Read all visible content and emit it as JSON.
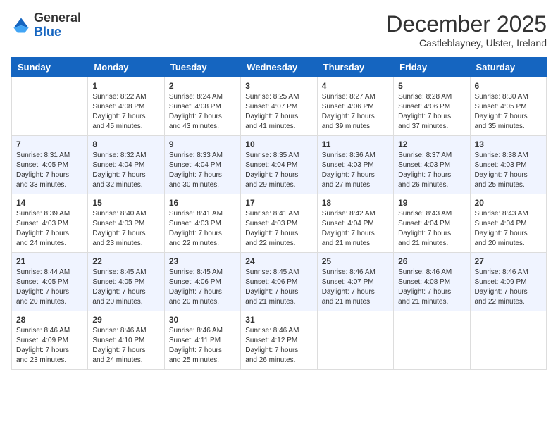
{
  "header": {
    "logo": {
      "general": "General",
      "blue": "Blue"
    },
    "title": "December 2025",
    "location": "Castleblayney, Ulster, Ireland"
  },
  "calendar": {
    "days_of_week": [
      "Sunday",
      "Monday",
      "Tuesday",
      "Wednesday",
      "Thursday",
      "Friday",
      "Saturday"
    ],
    "weeks": [
      [
        {
          "day": "",
          "content": ""
        },
        {
          "day": "1",
          "content": "Sunrise: 8:22 AM\nSunset: 4:08 PM\nDaylight: 7 hours\nand 45 minutes."
        },
        {
          "day": "2",
          "content": "Sunrise: 8:24 AM\nSunset: 4:08 PM\nDaylight: 7 hours\nand 43 minutes."
        },
        {
          "day": "3",
          "content": "Sunrise: 8:25 AM\nSunset: 4:07 PM\nDaylight: 7 hours\nand 41 minutes."
        },
        {
          "day": "4",
          "content": "Sunrise: 8:27 AM\nSunset: 4:06 PM\nDaylight: 7 hours\nand 39 minutes."
        },
        {
          "day": "5",
          "content": "Sunrise: 8:28 AM\nSunset: 4:06 PM\nDaylight: 7 hours\nand 37 minutes."
        },
        {
          "day": "6",
          "content": "Sunrise: 8:30 AM\nSunset: 4:05 PM\nDaylight: 7 hours\nand 35 minutes."
        }
      ],
      [
        {
          "day": "7",
          "content": "Sunrise: 8:31 AM\nSunset: 4:05 PM\nDaylight: 7 hours\nand 33 minutes."
        },
        {
          "day": "8",
          "content": "Sunrise: 8:32 AM\nSunset: 4:04 PM\nDaylight: 7 hours\nand 32 minutes."
        },
        {
          "day": "9",
          "content": "Sunrise: 8:33 AM\nSunset: 4:04 PM\nDaylight: 7 hours\nand 30 minutes."
        },
        {
          "day": "10",
          "content": "Sunrise: 8:35 AM\nSunset: 4:04 PM\nDaylight: 7 hours\nand 29 minutes."
        },
        {
          "day": "11",
          "content": "Sunrise: 8:36 AM\nSunset: 4:03 PM\nDaylight: 7 hours\nand 27 minutes."
        },
        {
          "day": "12",
          "content": "Sunrise: 8:37 AM\nSunset: 4:03 PM\nDaylight: 7 hours\nand 26 minutes."
        },
        {
          "day": "13",
          "content": "Sunrise: 8:38 AM\nSunset: 4:03 PM\nDaylight: 7 hours\nand 25 minutes."
        }
      ],
      [
        {
          "day": "14",
          "content": "Sunrise: 8:39 AM\nSunset: 4:03 PM\nDaylight: 7 hours\nand 24 minutes."
        },
        {
          "day": "15",
          "content": "Sunrise: 8:40 AM\nSunset: 4:03 PM\nDaylight: 7 hours\nand 23 minutes."
        },
        {
          "day": "16",
          "content": "Sunrise: 8:41 AM\nSunset: 4:03 PM\nDaylight: 7 hours\nand 22 minutes."
        },
        {
          "day": "17",
          "content": "Sunrise: 8:41 AM\nSunset: 4:03 PM\nDaylight: 7 hours\nand 22 minutes."
        },
        {
          "day": "18",
          "content": "Sunrise: 8:42 AM\nSunset: 4:04 PM\nDaylight: 7 hours\nand 21 minutes."
        },
        {
          "day": "19",
          "content": "Sunrise: 8:43 AM\nSunset: 4:04 PM\nDaylight: 7 hours\nand 21 minutes."
        },
        {
          "day": "20",
          "content": "Sunrise: 8:43 AM\nSunset: 4:04 PM\nDaylight: 7 hours\nand 20 minutes."
        }
      ],
      [
        {
          "day": "21",
          "content": "Sunrise: 8:44 AM\nSunset: 4:05 PM\nDaylight: 7 hours\nand 20 minutes."
        },
        {
          "day": "22",
          "content": "Sunrise: 8:45 AM\nSunset: 4:05 PM\nDaylight: 7 hours\nand 20 minutes."
        },
        {
          "day": "23",
          "content": "Sunrise: 8:45 AM\nSunset: 4:06 PM\nDaylight: 7 hours\nand 20 minutes."
        },
        {
          "day": "24",
          "content": "Sunrise: 8:45 AM\nSunset: 4:06 PM\nDaylight: 7 hours\nand 21 minutes."
        },
        {
          "day": "25",
          "content": "Sunrise: 8:46 AM\nSunset: 4:07 PM\nDaylight: 7 hours\nand 21 minutes."
        },
        {
          "day": "26",
          "content": "Sunrise: 8:46 AM\nSunset: 4:08 PM\nDaylight: 7 hours\nand 21 minutes."
        },
        {
          "day": "27",
          "content": "Sunrise: 8:46 AM\nSunset: 4:09 PM\nDaylight: 7 hours\nand 22 minutes."
        }
      ],
      [
        {
          "day": "28",
          "content": "Sunrise: 8:46 AM\nSunset: 4:09 PM\nDaylight: 7 hours\nand 23 minutes."
        },
        {
          "day": "29",
          "content": "Sunrise: 8:46 AM\nSunset: 4:10 PM\nDaylight: 7 hours\nand 24 minutes."
        },
        {
          "day": "30",
          "content": "Sunrise: 8:46 AM\nSunset: 4:11 PM\nDaylight: 7 hours\nand 25 minutes."
        },
        {
          "day": "31",
          "content": "Sunrise: 8:46 AM\nSunset: 4:12 PM\nDaylight: 7 hours\nand 26 minutes."
        },
        {
          "day": "",
          "content": ""
        },
        {
          "day": "",
          "content": ""
        },
        {
          "day": "",
          "content": ""
        }
      ]
    ]
  }
}
